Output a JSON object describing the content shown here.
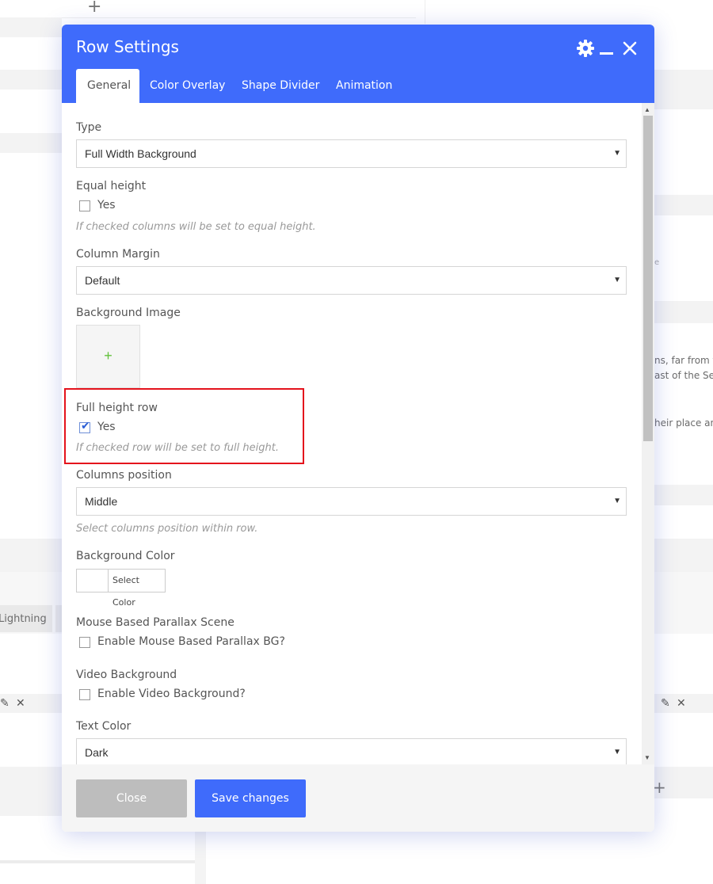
{
  "background": {
    "plus_icon": "+",
    "snippet_1": "e",
    "snippet_2": "ns, far from t",
    "snippet_3": "ast of the Ser",
    "snippet_4": "heir place and",
    "lightning_tab": "Lightning",
    "edit_icon": "✎",
    "close_icon": "✕"
  },
  "modal": {
    "title": "Row Settings",
    "icons": {
      "settings": "gear-icon",
      "minimize": "minimize-icon",
      "close": "close-icon"
    },
    "tabs": [
      {
        "label": "General",
        "active": true
      },
      {
        "label": "Color Overlay",
        "active": false
      },
      {
        "label": "Shape Divider",
        "active": false
      },
      {
        "label": "Animation",
        "active": false
      }
    ],
    "fields": {
      "type": {
        "label": "Type",
        "value": "Full Width Background"
      },
      "equal_height": {
        "label": "Equal height",
        "option": "Yes",
        "checked": false,
        "help": "If checked columns will be set to equal height."
      },
      "column_margin": {
        "label": "Column Margin",
        "value": "Default"
      },
      "background_image": {
        "label": "Background Image",
        "add_icon": "+"
      },
      "full_height": {
        "label": "Full height row",
        "option": "Yes",
        "checked": true,
        "help": "If checked row will be set to full height."
      },
      "columns_position": {
        "label": "Columns position",
        "value": "Middle",
        "help": "Select columns position within row."
      },
      "background_color": {
        "label": "Background Color",
        "button": "Select Color"
      },
      "mouse_parallax": {
        "label": "Mouse Based Parallax Scene",
        "option": "Enable Mouse Based Parallax BG?",
        "checked": false
      },
      "video_background": {
        "label": "Video Background",
        "option": "Enable Video Background?",
        "checked": false
      },
      "text_color": {
        "label": "Text Color",
        "value": "Dark"
      }
    },
    "footer": {
      "close_label": "Close",
      "save_label": "Save changes"
    }
  },
  "colors": {
    "header": "#3f6bfb",
    "save_button": "#3f6bfb",
    "close_button": "#bdbdbd",
    "highlight": "#e4121c",
    "checkmark": "#2c5fd6"
  }
}
